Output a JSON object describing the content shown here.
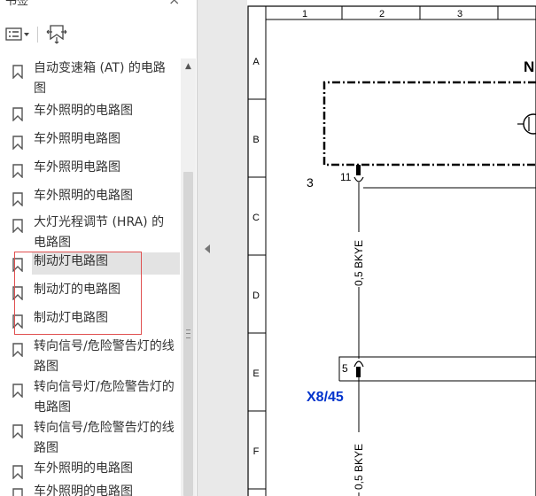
{
  "panel": {
    "title": "书签",
    "close": "×"
  },
  "toolbar": {
    "options_icon": "bookmark-options-icon",
    "expand_icon": "expand-bookmark-icon"
  },
  "bookmarks": [
    {
      "label": "自动变速箱 (AT) 的电路图"
    },
    {
      "label": "车外照明的电路图"
    },
    {
      "label": "车外照明电路图"
    },
    {
      "label": "车外照明电路图"
    },
    {
      "label": "车外照明的电路图"
    },
    {
      "label": "大灯光程调节 (HRA) 的电路图"
    },
    {
      "label": "制动灯电路图"
    },
    {
      "label": "制动灯的电路图"
    },
    {
      "label": "制动灯电路图"
    },
    {
      "label": "转向信号/危险警告灯的线路图"
    },
    {
      "label": "转向信号灯/危险警告灯的电路图"
    },
    {
      "label": "转向信号/危险警告灯的线路图"
    },
    {
      "label": "车外照明的电路图"
    },
    {
      "label": "车外照明的电路图"
    }
  ],
  "selected_index": 6,
  "document": {
    "columns": [
      "1",
      "2",
      "3"
    ],
    "rows": [
      "A",
      "B",
      "C",
      "D",
      "E",
      "F"
    ],
    "component_label": "N",
    "pin_top": "11",
    "ref_3": "3",
    "wire_label_1": "0,5 BKYE",
    "pin_bottom": "5",
    "connector": "X8/45",
    "wire_label_2": "0,5 BKYE",
    "connector_color": "#0033cc"
  }
}
